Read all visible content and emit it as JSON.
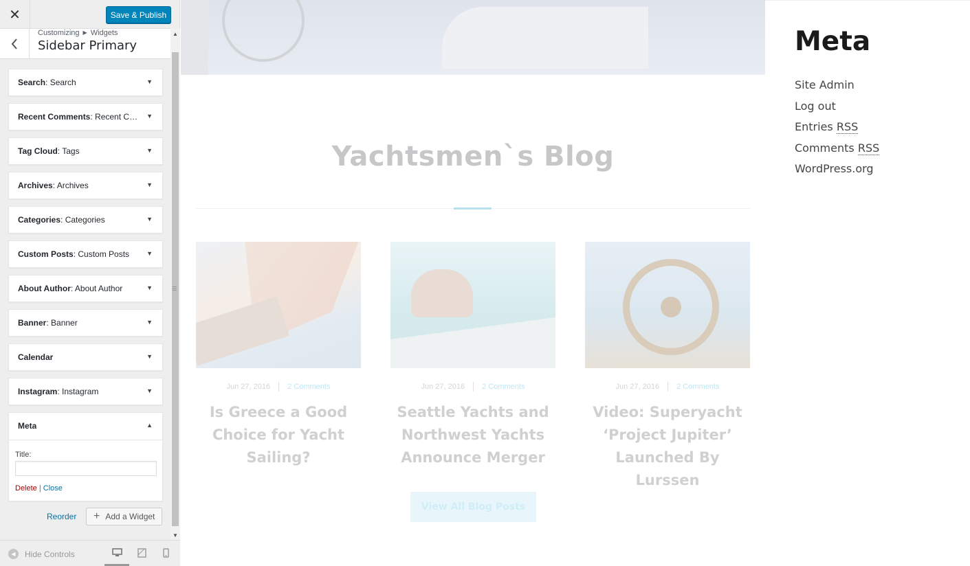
{
  "header": {
    "close_icon": "✕",
    "save_label": "Save & Publish"
  },
  "section": {
    "breadcrumb_root": "Customizing",
    "breadcrumb_child": "Widgets",
    "title": "Sidebar Primary"
  },
  "widgets": [
    {
      "type": "Search",
      "name": "Search"
    },
    {
      "type": "Recent Comments",
      "name": "Recent Co..."
    },
    {
      "type": "Tag Cloud",
      "name": "Tags"
    },
    {
      "type": "Archives",
      "name": "Archives"
    },
    {
      "type": "Categories",
      "name": "Categories"
    },
    {
      "type": "Custom Posts",
      "name": "Custom Posts"
    },
    {
      "type": "About Author",
      "name": "About Author"
    },
    {
      "type": "Banner",
      "name": "Banner"
    },
    {
      "type": "Calendar",
      "name": ""
    },
    {
      "type": "Instagram",
      "name": "Instagram"
    }
  ],
  "open_widget": {
    "type": "Meta",
    "field_label": "Title:",
    "field_value": "",
    "delete_label": "Delete",
    "separator": "|",
    "close_label": "Close"
  },
  "controls": {
    "reorder_label": "Reorder",
    "add_widget_label": "Add a Widget",
    "hide_controls_label": "Hide Controls"
  },
  "preview": {
    "blog_title": "Yachtsmen`s Blog",
    "posts": [
      {
        "date": "Jun 27, 2016",
        "comments": "2 Comments",
        "title": "Is Greece a Good Choice for Yacht Sailing?"
      },
      {
        "date": "Jun 27, 2016",
        "comments": "2 Comments",
        "title": "Seattle Yachts and Northwest Yachts Announce Merger"
      },
      {
        "date": "Jun 27, 2016",
        "comments": "2 Comments",
        "title": "Video: Superyacht ‘Project Jupiter’ Launched By Lurssen"
      }
    ],
    "view_all_label": "View All Blog Posts",
    "meta_widget": {
      "title": "Meta",
      "links": {
        "site_admin": "Site Admin",
        "log_out": "Log out",
        "entries": "Entries",
        "entries_abbr": "RSS",
        "comments": "Comments",
        "comments_abbr": "RSS",
        "wordpress": "WordPress.org"
      }
    }
  },
  "colors": {
    "primary_button": "#0085ba",
    "link": "#0073aa",
    "delete": "#a00000"
  }
}
